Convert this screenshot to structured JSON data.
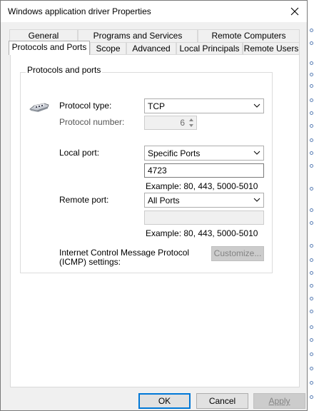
{
  "window": {
    "title": "Windows application driver Properties"
  },
  "tabs": {
    "row1": [
      {
        "label": "General"
      },
      {
        "label": "Programs and Services"
      },
      {
        "label": "Remote Computers"
      }
    ],
    "row2": [
      {
        "label": "Protocols and Ports"
      },
      {
        "label": "Scope"
      },
      {
        "label": "Advanced"
      },
      {
        "label": "Local Principals"
      },
      {
        "label": "Remote Users"
      }
    ]
  },
  "group": {
    "title": "Protocols and ports",
    "protocol_type_label": "Protocol type:",
    "protocol_type_value": "TCP",
    "protocol_number_label": "Protocol number:",
    "protocol_number_value": "6",
    "local_port_label": "Local port:",
    "local_port_mode": "Specific Ports",
    "local_port_value": "4723",
    "local_port_example": "Example: 80, 443, 5000-5010",
    "remote_port_label": "Remote port:",
    "remote_port_mode": "All Ports",
    "remote_port_value": "",
    "remote_port_example": "Example: 80, 443, 5000-5010",
    "icmp_label_line1": "Internet Control Message Protocol",
    "icmp_label_line2": "(ICMP) settings:",
    "customize_label": "Customize..."
  },
  "footer": {
    "ok_label": "OK",
    "cancel_label": "Cancel",
    "apply_label": "Apply"
  },
  "colors": {
    "accent": "#0078d7"
  }
}
